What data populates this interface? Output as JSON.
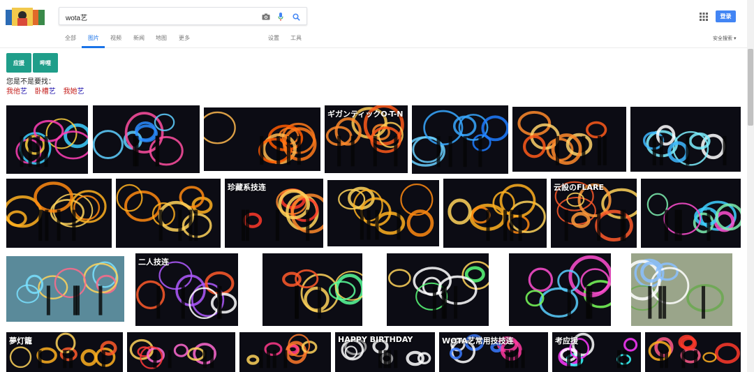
{
  "search": {
    "query": "wota艺"
  },
  "header": {
    "login_label": "登录"
  },
  "tabs": [
    {
      "label": "全部"
    },
    {
      "label": "图片",
      "active": true
    },
    {
      "label": "视频"
    },
    {
      "label": "新闻"
    },
    {
      "label": "地图"
    },
    {
      "label": "更多"
    },
    {
      "label": "设置"
    },
    {
      "label": "工具"
    }
  ],
  "safe_search": "安全搜索 ▾",
  "chips": [
    {
      "label": "应援"
    },
    {
      "label": "哔哩"
    }
  ],
  "did_you_mean": "您是不是要找：",
  "suggestions": [
    {
      "prefix": "我他",
      "suffix": "艺"
    },
    {
      "prefix": "卧槽",
      "suffix": "艺"
    },
    {
      "prefix": "我她",
      "suffix": "艺"
    }
  ],
  "images": [
    {
      "name": "image-1-1",
      "caption": "",
      "colors": [
        "#ff3fb5",
        "#3fd0ff",
        "#ffd23f"
      ]
    },
    {
      "name": "image-1-2",
      "caption": "",
      "colors": [
        "#5fd0ff",
        "#2a8cff",
        "#ff4fa0"
      ]
    },
    {
      "name": "image-1-3",
      "caption": "",
      "colors": [
        "#ff7a1a",
        "#ffb84d",
        "#ff5a00"
      ]
    },
    {
      "name": "image-1-4",
      "caption": "ギガンティックO-T-N",
      "colors": [
        "#ff8a2a",
        "#ffcc55",
        "#ff5a1a"
      ]
    },
    {
      "name": "image-1-5",
      "caption": "",
      "colors": [
        "#38a8ff",
        "#6ad0ff",
        "#1e7cff"
      ]
    },
    {
      "name": "image-1-6",
      "caption": "",
      "colors": [
        "#ff8a2a",
        "#ffd26a",
        "#ff5a1a"
      ]
    },
    {
      "name": "image-1-7",
      "caption": "",
      "colors": [
        "#7ef0ff",
        "#3fb8ff",
        "#ffffff"
      ]
    },
    {
      "name": "image-2-1",
      "caption": "",
      "colors": [
        "#ffb020",
        "#ffd45a",
        "#ff8a10"
      ]
    },
    {
      "name": "image-2-2",
      "caption": "",
      "colors": [
        "#ffb020",
        "#ff8a10",
        "#ffd45a"
      ]
    },
    {
      "name": "image-2-3",
      "caption": "珍藏系技连",
      "colors": [
        "#ff3a2a",
        "#ff8a2a",
        "#ffd45a"
      ]
    },
    {
      "name": "image-2-4",
      "caption": "",
      "colors": [
        "#ffb020",
        "#ffd45a",
        "#ff8a10"
      ]
    },
    {
      "name": "image-2-5",
      "caption": "",
      "colors": [
        "#ffb020",
        "#ff8a10",
        "#ffd45a"
      ]
    },
    {
      "name": "image-2-6",
      "caption": "云設のFLARE",
      "colors": [
        "#ff5a2a",
        "#ff9a3a",
        "#ffd45a"
      ]
    },
    {
      "name": "image-2-7",
      "caption": "",
      "colors": [
        "#7ef0b0",
        "#3fd0ff",
        "#ff4fd0"
      ]
    },
    {
      "name": "image-3-1",
      "caption": "",
      "colors": [
        "#7ae0ff",
        "#ffd45a",
        "#ff6a8a"
      ]
    },
    {
      "name": "image-3-2",
      "caption": "二人技连",
      "colors": [
        "#b05aff",
        "#ff5a2a",
        "#ffffff"
      ]
    },
    {
      "name": "image-3-3",
      "caption": "",
      "colors": [
        "#ffd45a",
        "#ff5a2a",
        "#5aff9a"
      ]
    },
    {
      "name": "image-3-4",
      "caption": "",
      "colors": [
        "#ffffff",
        "#5aff7a",
        "#ffd45a"
      ]
    },
    {
      "name": "image-3-5",
      "caption": "",
      "colors": [
        "#ff4fd0",
        "#5ad0ff",
        "#7aff5a"
      ]
    },
    {
      "name": "image-3-6",
      "caption": "",
      "colors": [
        "#8ac0ff",
        "#6aa84f",
        "#ffffff"
      ]
    },
    {
      "name": "image-4-1",
      "caption": "夢灯籠",
      "colors": [
        "#ffb020",
        "#ff5a2a",
        "#ffd45a"
      ]
    },
    {
      "name": "image-4-2",
      "caption": "",
      "colors": [
        "#ff6ad0",
        "#ff3a3a",
        "#ffd45a"
      ]
    },
    {
      "name": "image-4-3",
      "caption": "",
      "colors": [
        "#ff7a2a",
        "#ff3a8a",
        "#ffd45a"
      ]
    },
    {
      "name": "image-4-4",
      "caption": "HAPPY BIRTHDAY",
      "colors": [
        "#ffffff",
        "#aaaaaa",
        "#ffffff"
      ]
    },
    {
      "name": "image-4-5",
      "caption": "WOTA艺常用技技连",
      "colors": [
        "#3a7aff",
        "#ff3aa0",
        "#ffffff"
      ]
    },
    {
      "name": "image-4-6",
      "caption": "考应援",
      "colors": [
        "#ff3aff",
        "#3affff",
        "#ffffff"
      ]
    },
    {
      "name": "image-4-7",
      "caption": "",
      "colors": [
        "#ff3a2a",
        "#ffb020",
        "#ff5a8a"
      ]
    }
  ]
}
